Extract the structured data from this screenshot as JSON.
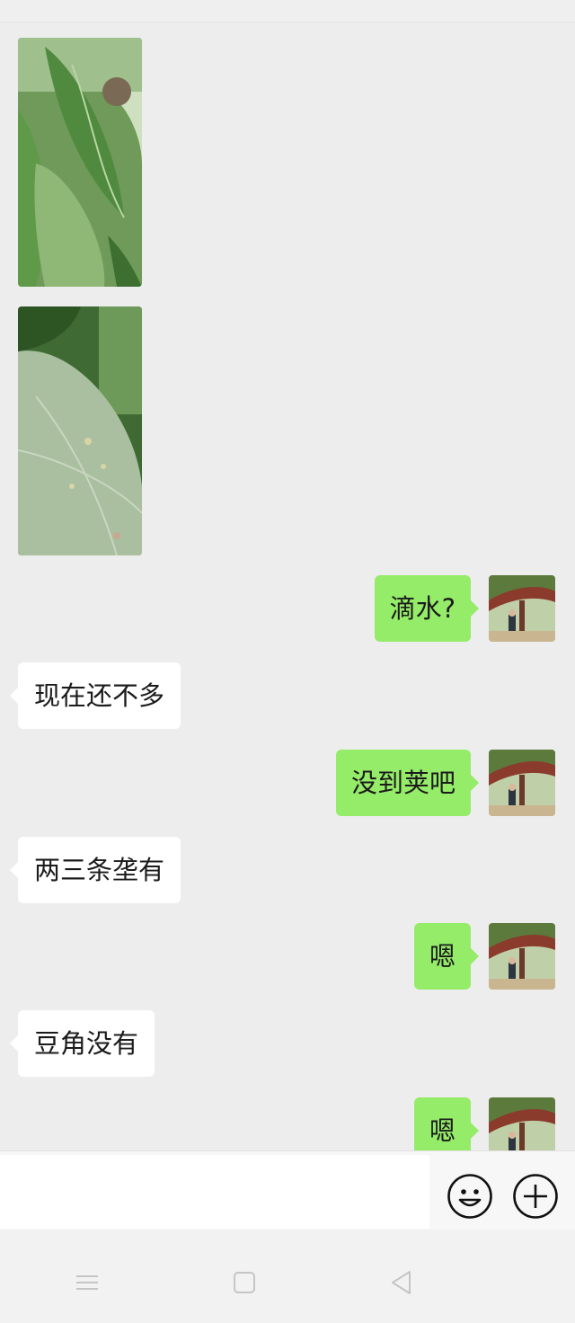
{
  "messages": [
    {
      "type": "image",
      "side": "in",
      "content": "leaf-photo-1"
    },
    {
      "type": "image",
      "side": "in",
      "content": "leaf-photo-2"
    },
    {
      "type": "text",
      "side": "out",
      "text": "滴水?"
    },
    {
      "type": "text",
      "side": "in",
      "text": "现在还不多"
    },
    {
      "type": "text",
      "side": "out",
      "text": "没到荚吧"
    },
    {
      "type": "text",
      "side": "in",
      "text": "两三条垄有"
    },
    {
      "type": "text",
      "side": "out",
      "text": "嗯"
    },
    {
      "type": "text",
      "side": "in",
      "text": "豆角没有"
    },
    {
      "type": "text",
      "side": "out",
      "text": "嗯"
    }
  ],
  "input_bar": {
    "input_value": "",
    "icons": [
      "emoji-icon",
      "plus-icon"
    ]
  },
  "nav_bar": {
    "icons": [
      "menu-icon",
      "home-icon",
      "back-icon"
    ]
  },
  "colors": {
    "background": "#ededed",
    "outgoing_bubble": "#95ec69",
    "incoming_bubble": "#ffffff"
  }
}
